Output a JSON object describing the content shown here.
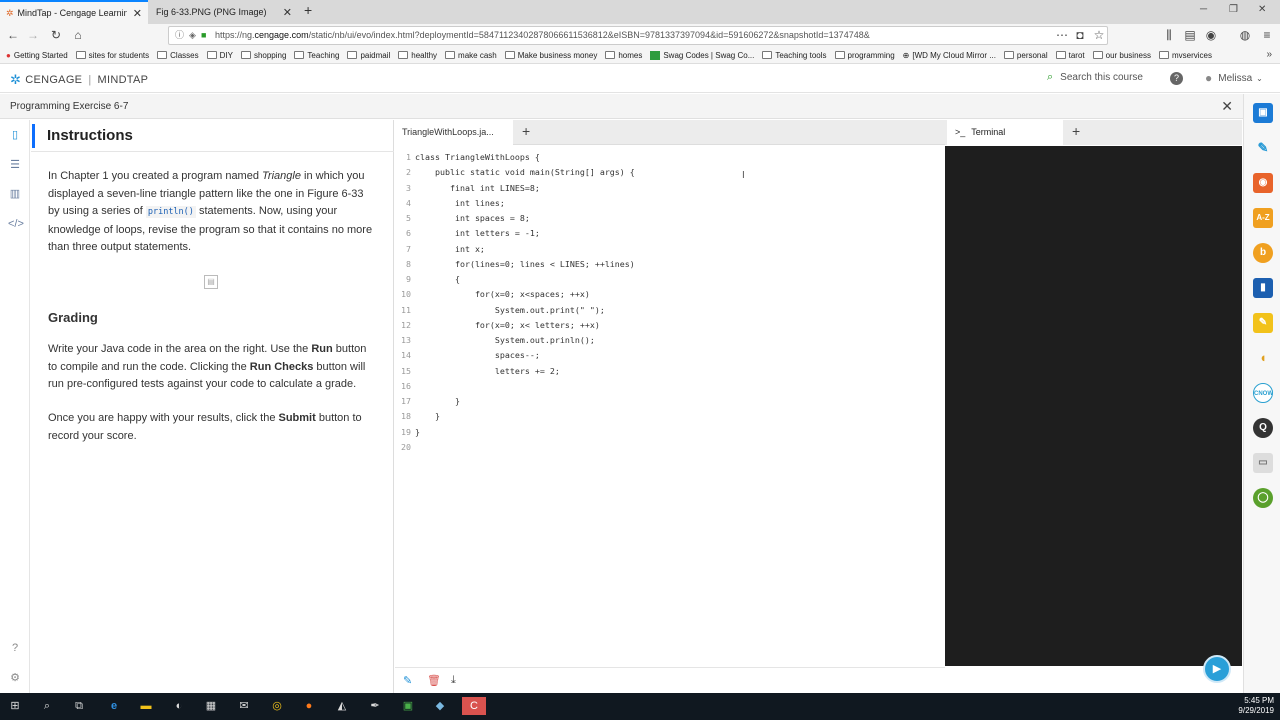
{
  "browser": {
    "tabs": [
      {
        "label": "MindTap - Cengage Learning",
        "active": true
      },
      {
        "label": "Fig 6-33.PNG (PNG Image)",
        "active": false
      }
    ],
    "url_prefix": "https://ng.",
    "url_domain": "cengage.com",
    "url_rest": "/static/nb/ui/evo/index.html?deploymentId=58471123402878066611536812&eISBN=9781337397094&id=591606272&snapshotId=1374748&",
    "bookmarks": [
      "Getting Started",
      "sites for students",
      "Classes",
      "DIY",
      "shopping",
      "Teaching",
      "paidmail",
      "healthy",
      "make cash",
      "Make business money",
      "homes",
      "Swag Codes | Swag Co...",
      "Teaching tools",
      "programming",
      "[WD My Cloud Mirror ...",
      "personal",
      "tarot",
      "our business",
      "mvservices"
    ]
  },
  "app": {
    "brand": "CENGAGE",
    "product": "MINDTAP",
    "search_label": "Search this course",
    "help_label": "?",
    "user_name": "Melissa"
  },
  "exercise": {
    "title": "Programming Exercise 6-7"
  },
  "instructions": {
    "heading": "Instructions",
    "p1_a": "In Chapter 1 you created a program named ",
    "p1_em": "Triangle",
    "p1_b": " in which you displayed a seven-line triangle pattern like the one in Figure 6-33 by using a series of ",
    "p1_code": "println()",
    "p1_c": " statements. Now, using your knowledge of loops, revise the program so that it contains no more than three output statements.",
    "grading_heading": "Grading",
    "p2_a": "Write your Java code in the area on the right. Use the ",
    "p2_run": "Run",
    "p2_b": " button to compile and run the code. Clicking the ",
    "p2_checks": "Run Checks",
    "p2_c": " button will run pre-configured tests against your code to calculate a grade.",
    "p3_a": "Once you are happy with your results, click the ",
    "p3_submit": "Submit",
    "p3_b": " button to record your score."
  },
  "editor": {
    "tab_label": "TriangleWithLoops.ja...",
    "lines": [
      "class TriangleWithLoops {",
      "    public static void main(String[] args) {",
      "       final int LINES=8;",
      "        int lines;",
      "        int spaces = 8;",
      "        int letters = -1;",
      "        int x;",
      "        for(lines=0; lines < LINES; ++lines)",
      "        {",
      "            for(x=0; x<spaces; ++x)",
      "                System.out.print(\" \");",
      "            for(x=0; x< letters; ++x)",
      "                System.out.prinln();",
      "                spaces--;",
      "                letters += 2;",
      "",
      "        }",
      "    }",
      "}",
      ""
    ]
  },
  "terminal": {
    "tab_label": "Terminal"
  },
  "taskbar": {
    "time": "5:45 PM",
    "date": "9/29/2019"
  }
}
